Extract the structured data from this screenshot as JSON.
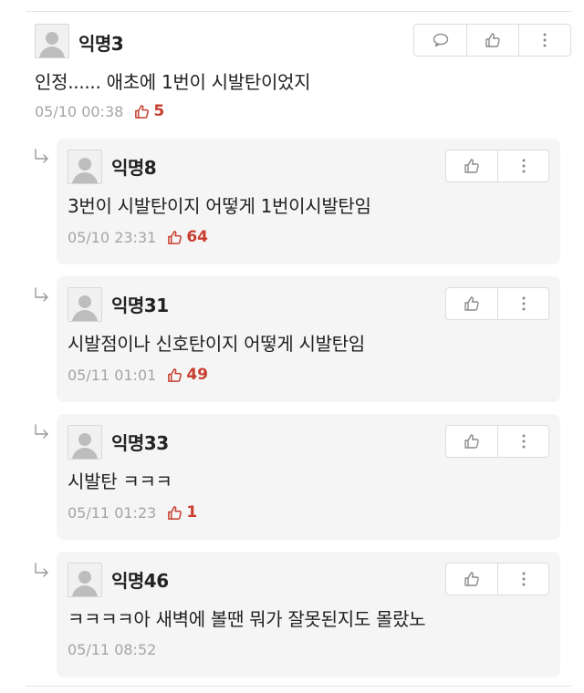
{
  "parent": {
    "nickname": "익명3",
    "text": "인정...... 애초에 1번이 시발탄이었지",
    "time": "05/10 00:38",
    "likes": "5"
  },
  "replies": [
    {
      "nickname": "익명8",
      "text": "3번이 시발탄이지 어떻게 1번이시발탄임",
      "time": "05/10 23:31",
      "likes": "64"
    },
    {
      "nickname": "익명31",
      "text": "시발점이나 신호탄이지 어떻게 시발탄임",
      "time": "05/11 01:01",
      "likes": "49"
    },
    {
      "nickname": "익명33",
      "text": "시발탄 ㅋㅋㅋ",
      "time": "05/11 01:23",
      "likes": "1"
    },
    {
      "nickname": "익명46",
      "text": "ㅋㅋㅋㅋ아 새벽에 볼땐 뭐가 잘못된지도 몰랐노",
      "time": "05/11 08:52",
      "likes": ""
    }
  ],
  "icons": {
    "reply": "speech-bubble-icon",
    "like": "thumbs-up-icon",
    "more": "vertical-dots-icon",
    "reply_indicator": "reply-arrow-icon"
  },
  "colors": {
    "like_count": "#c83d2f",
    "meta": "#a5a5a5",
    "reply_background": "#f5f5f5"
  }
}
